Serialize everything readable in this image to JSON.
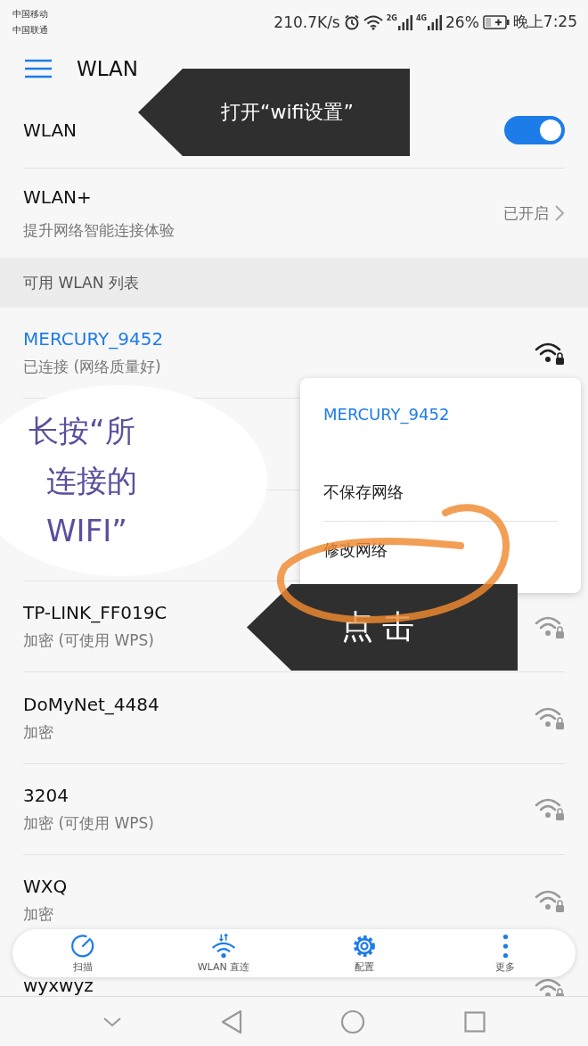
{
  "status_bar": {
    "carriers": [
      "中国移动",
      "中国联通"
    ],
    "speed": "210.7K/s",
    "sim1_label": "2G",
    "sim2_label": "4G",
    "battery": "26%",
    "time": "晚上7:25"
  },
  "app_bar": {
    "title": "WLAN"
  },
  "wlan_toggle": {
    "label": "WLAN",
    "on": true
  },
  "wlan_plus": {
    "title": "WLAN+",
    "subtitle": "提升网络智能连接体验",
    "status": "已开启"
  },
  "section_header": "可用 WLAN 列表",
  "networks": [
    {
      "name": "MERCURY_9452",
      "status": "已连接 (网络质量好)",
      "connected": true
    },
    {
      "name": "TP-LINK_FF019C",
      "status": "加密 (可使用 WPS)",
      "connected": false
    },
    {
      "name": "DoMyNet_4484",
      "status": "加密",
      "connected": false
    },
    {
      "name": "3204",
      "status": "加密 (可使用 WPS)",
      "connected": false
    },
    {
      "name": "WXQ",
      "status": "加密",
      "connected": false
    },
    {
      "name": "wyxwyz",
      "connected": false
    }
  ],
  "context_menu": {
    "title": "MERCURY_9452",
    "items": [
      "不保存网络",
      "修改网络"
    ]
  },
  "callout_top": {
    "text": "打开“wifi设置”"
  },
  "bubble": {
    "lines": [
      "长按“所",
      "连接的",
      "WIFI”"
    ]
  },
  "callout_bottom": {
    "text": "点击"
  },
  "toolbar": [
    {
      "label": "扫描",
      "kind": "scan"
    },
    {
      "label": "WLAN 直连",
      "kind": "direct"
    },
    {
      "label": "配置",
      "kind": "settings"
    },
    {
      "label": "更多",
      "kind": "more"
    }
  ]
}
